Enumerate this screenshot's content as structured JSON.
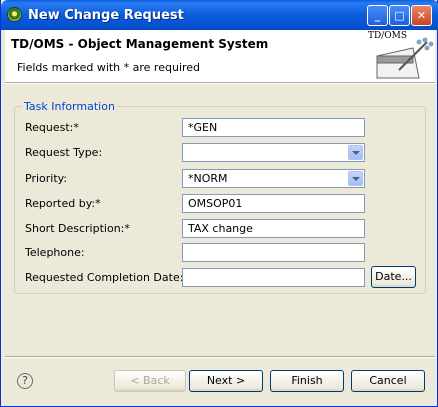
{
  "window": {
    "title": "New Change Request",
    "minimize_label": "_",
    "maximize_label": "□",
    "close_label": "✕"
  },
  "header": {
    "title": "TD/OMS - Object Management System",
    "subtitle": "Fields marked with * are required",
    "banner_text": "TD/OMS"
  },
  "group": {
    "label": "Task Information"
  },
  "fields": {
    "request": {
      "label": "Request:*",
      "value": "*GEN"
    },
    "request_type": {
      "label": "Request Type:",
      "value": ""
    },
    "priority": {
      "label": "Priority:",
      "value": "*NORM"
    },
    "reported_by": {
      "label": "Reported by:*",
      "value": "OMSOP01"
    },
    "short_description": {
      "label": "Short Description:*",
      "value": "TAX change"
    },
    "telephone": {
      "label": "Telephone:",
      "value": ""
    },
    "completion_date": {
      "label": "Requested Completion Date:",
      "value": "",
      "button_label": "Date..."
    }
  },
  "footer": {
    "help_label": "?",
    "back_label": "< Back",
    "next_label": "Next >",
    "finish_label": "Finish",
    "cancel_label": "Cancel"
  }
}
